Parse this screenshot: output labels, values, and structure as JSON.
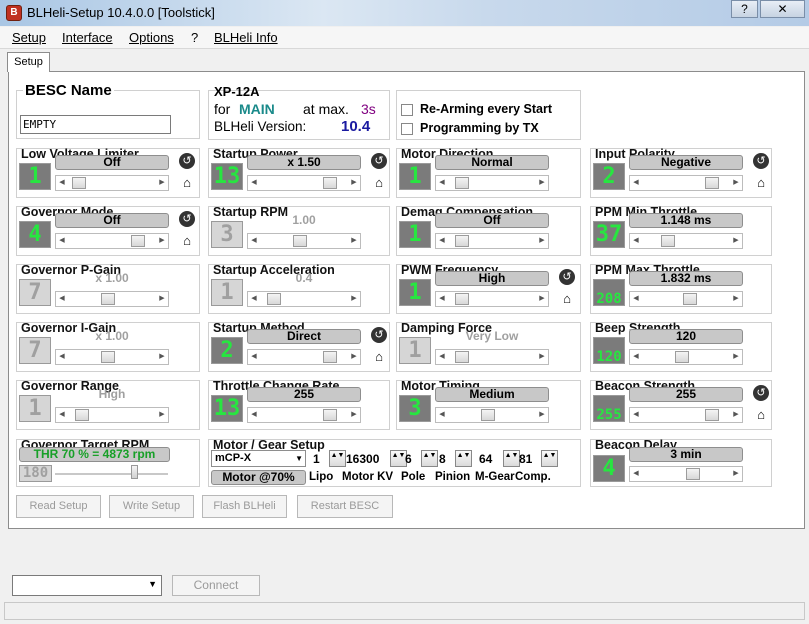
{
  "window": {
    "title": "BLHeli-Setup 10.4.0.0 [Toolstick]",
    "help": "?",
    "close": "✕"
  },
  "menu": {
    "setup": "Setup",
    "interface": "Interface",
    "options": "Options",
    "help": "?",
    "blheli_info": "BLHeli Info"
  },
  "tabs": {
    "setup": "Setup"
  },
  "besc": {
    "label": "BESC Name",
    "name": "EMPTY"
  },
  "info": {
    "model": "XP-12A",
    "for": "for",
    "target": "MAIN",
    "at_max": "at max.",
    "max_time": "3s",
    "version_label": "BLHeli Version:",
    "version": "10.4"
  },
  "checks": {
    "rearm": "Re-Arming every Start",
    "program_tx": "Programming by TX"
  },
  "params": [
    {
      "label": "Low Voltage Limiter",
      "value": "Off",
      "index": "1",
      "enabled": true,
      "pos": 0.05
    },
    {
      "label": "Startup Power",
      "value": "x 1.50",
      "index": "13",
      "enabled": true,
      "pos": 0.85
    },
    {
      "label": "Motor Direction",
      "value": "Normal",
      "index": "1",
      "enabled": true,
      "pos": 0.1
    },
    {
      "label": "Input Polarity",
      "value": "Negative",
      "index": "2",
      "enabled": true,
      "pos": 0.85
    },
    {
      "label": "Governor Mode",
      "value": "Off",
      "index": "4",
      "enabled": true,
      "pos": 0.85
    },
    {
      "label": "Startup RPM",
      "value": "1.00",
      "index": "3",
      "enabled": false,
      "pos": 0.45
    },
    {
      "label": "Demag Compensation",
      "value": "Off",
      "index": "1",
      "enabled": true,
      "pos": 0.1
    },
    {
      "label": "PPM Min Throttle",
      "value": "1.148 ms",
      "index": "37",
      "enabled": true,
      "pos": 0.25
    },
    {
      "label": "Governor P-Gain",
      "value": "x 1.00",
      "index": "7",
      "enabled": false,
      "pos": 0.45
    },
    {
      "label": "Startup Acceleration",
      "value": "0.4",
      "index": "1",
      "enabled": false,
      "pos": 0.1
    },
    {
      "label": "PWM Frequency",
      "value": "High",
      "index": "1",
      "enabled": true,
      "pos": 0.1
    },
    {
      "label": "PPM Max Throttle",
      "value": "1.832 ms",
      "index": "208",
      "enabled": true,
      "pos": 0.55
    },
    {
      "label": "Governor I-Gain",
      "value": "x 1.00",
      "index": "7",
      "enabled": false,
      "pos": 0.45
    },
    {
      "label": "Startup Method",
      "value": "Direct",
      "index": "2",
      "enabled": true,
      "pos": 0.85
    },
    {
      "label": "Damping Force",
      "value": "Very Low",
      "index": "1",
      "enabled": false,
      "pos": 0.1
    },
    {
      "label": "Beep Strength",
      "value": "120",
      "index": "120",
      "enabled": true,
      "pos": 0.45
    },
    {
      "label": "Governor Range",
      "value": "High",
      "index": "1",
      "enabled": false,
      "pos": 0.1
    },
    {
      "label": "Throttle Change  Rate",
      "value": "255",
      "index": "13",
      "enabled": true,
      "pos": 0.85
    },
    {
      "label": "Motor Timing",
      "value": "Medium",
      "index": "3",
      "enabled": true,
      "pos": 0.45
    },
    {
      "label": "Beacon Strength",
      "value": "255",
      "index": "255",
      "enabled": true,
      "pos": 0.85
    }
  ],
  "governor_target": {
    "label": "Governor Target RPM",
    "value": "THR 70 % = 4873 rpm",
    "index": "180"
  },
  "beacon_delay": {
    "label": "Beacon Delay",
    "value": "3 min",
    "index": "4",
    "pos": 0.6
  },
  "motor_gear": {
    "label": "Motor / Gear Setup",
    "model": "mCP-X",
    "motor_pct": "Motor @70%",
    "fields": [
      {
        "value": "1",
        "label": "Lipo"
      },
      {
        "value": "16300",
        "label": "Motor KV"
      },
      {
        "value": "6",
        "label": "Pole"
      },
      {
        "value": "8",
        "label": "Pinion"
      },
      {
        "value": "64",
        "label": "M-Gear"
      },
      {
        "value": "81",
        "label": "Comp."
      }
    ]
  },
  "buttons": {
    "read": "Read Setup",
    "write": "Write Setup",
    "flash": "Flash BLHeli",
    "restart": "Restart BESC",
    "connect": "Connect"
  },
  "colors": {
    "led_green": "#27e640",
    "teal": "#1a8a8a",
    "version_blue": "#1a1aa0",
    "purple": "#800080"
  }
}
